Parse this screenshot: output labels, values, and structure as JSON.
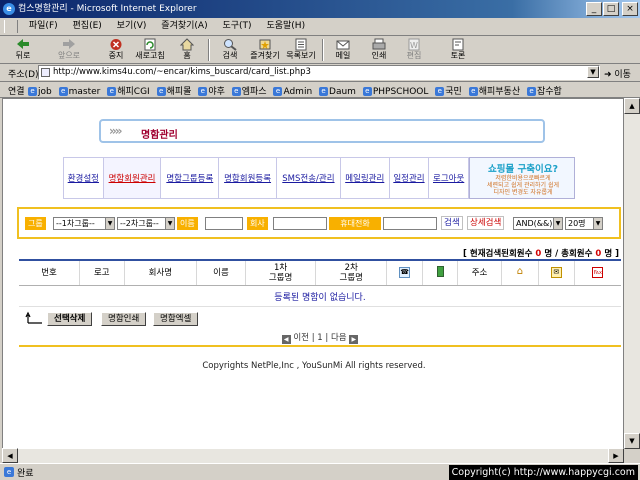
{
  "window": {
    "title": "컴스명함관리 - Microsoft Internet Explorer",
    "minimize": "_",
    "maximize": "□",
    "close": "×"
  },
  "menu": [
    "파일(F)",
    "편집(E)",
    "보기(V)",
    "즐겨찾기(A)",
    "도구(T)",
    "도움말(H)"
  ],
  "toolbar": {
    "back": "뒤로",
    "forward": "앞으로",
    "stop": "중지",
    "refresh": "새로고침",
    "home": "홈",
    "search": "검색",
    "favorites": "즐겨찾기",
    "history": "목록보기",
    "mail": "메일",
    "print": "인쇄",
    "edit": "편집",
    "discuss": "토론"
  },
  "address": {
    "label": "주소(D)",
    "url": "http://www.kims4u.com/~encar/kims_buscard/card_list.php3",
    "go": "이동"
  },
  "links": {
    "label": "연결",
    "items": [
      "job",
      "master",
      "해피CGI",
      "해피몰",
      "야후",
      "엠파스",
      "Admin",
      "Daum",
      "PHPSCHOOL",
      "국민",
      "해피부동산",
      "잡수합"
    ]
  },
  "page": {
    "title": "명함관리",
    "nav": [
      "환경설정",
      "명함회원관리",
      "명함그룹등록",
      "명함회원등록",
      "SMS전송/관리",
      "메일링관리",
      "일정관리",
      "로그아웃"
    ],
    "nav_active_index": 1,
    "shop_banner": {
      "headline": "쇼핑몰 구축이요?",
      "lines": [
        "저렴한비용으로빠르게",
        "세련되고 쉽게 관리하기 쉽게",
        "디자인 변경도 자유롭게"
      ]
    },
    "search": {
      "group_label": "그룹",
      "group1": "--1차그룹--",
      "group2": "--2차그룹--",
      "name_label": "이름",
      "company_label": "회사",
      "phone_label": "휴대전화",
      "search_link": "검색",
      "detail_link": "상세검색",
      "logic": "AND(&&)",
      "per_page": "20명"
    },
    "count": {
      "open": "[",
      "found_label": "현재검색된회원수",
      "found": "0",
      "unit1": "명 /",
      "total_label": "총회원수",
      "total": "0",
      "unit2": "명",
      "close": "]"
    },
    "columns": [
      "번호",
      "로고",
      "회사명",
      "이름",
      "1차 그룹명",
      "2차 그룹명",
      "phone-icon",
      "mobile-icon",
      "주소",
      "home-icon",
      "mail-icon",
      "fax-icon"
    ],
    "col_text": {
      "no": "번호",
      "logo": "로고",
      "company": "회사명",
      "name": "이름",
      "g1a": "1차",
      "g1b": "그룹명",
      "g2a": "2차",
      "g2b": "그룹명",
      "address": "주소"
    },
    "empty_message": "등록된 명함이 없습니다.",
    "actions": {
      "delete_selected": "선택삭제",
      "print_cards": "명함인쇄",
      "excel": "명함엑셀"
    },
    "pager": {
      "prev": "이전",
      "current": "1",
      "next": "다음"
    },
    "footer": "Copyrights NetPle,Inc , YouSunMi All rights reserved."
  },
  "status": {
    "text": "완료",
    "overlay": "Copyright(c) http://www.happycgi.com"
  },
  "colors": {
    "titlebar": "#0a246a",
    "accent_orange": "#f8b000",
    "title_red": "#a00030",
    "link_blue": "#1a1aa0"
  }
}
